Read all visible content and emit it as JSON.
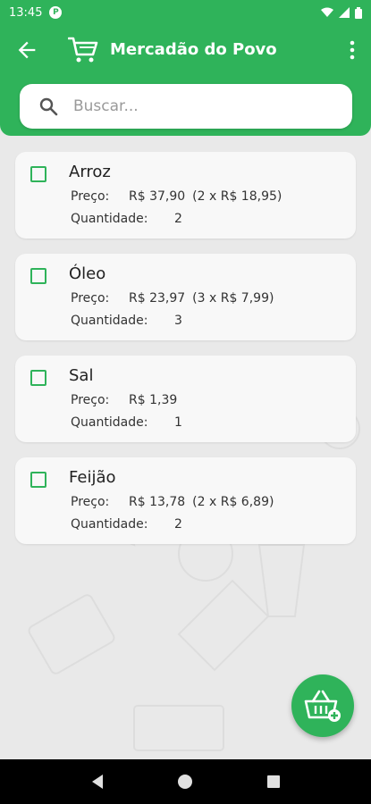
{
  "status_bar": {
    "time": "13:45",
    "app_badge": "P",
    "icons": [
      "wifi-icon",
      "signal-icon",
      "battery-icon"
    ]
  },
  "appbar": {
    "title": "Mercadão do Povo",
    "back_icon": "arrow-back-icon",
    "cart_icon": "shopping-cart-icon",
    "menu_icon": "more-vert-icon"
  },
  "search": {
    "placeholder": "Buscar...",
    "value": ""
  },
  "labels": {
    "price": "Preço:",
    "quantity": "Quantidade:"
  },
  "items": [
    {
      "name": "Arroz",
      "price": "R$ 37,90",
      "detail": "(2 x R$ 18,95)",
      "quantity": "2",
      "checked": false
    },
    {
      "name": "Óleo",
      "price": "R$ 23,97",
      "detail": "(3 x R$ 7,99)",
      "quantity": "3",
      "checked": false
    },
    {
      "name": "Sal",
      "price": "R$ 1,39",
      "detail": "",
      "quantity": "1",
      "checked": false
    },
    {
      "name": "Feijão",
      "price": "R$ 13,78",
      "detail": "(2 x R$ 6,89)",
      "quantity": "2",
      "checked": false
    }
  ],
  "fab": {
    "icon": "add-to-basket-icon"
  },
  "colors": {
    "primary": "#2fb35a",
    "background": "#e9e9e9",
    "card": "#f8f8f8"
  }
}
